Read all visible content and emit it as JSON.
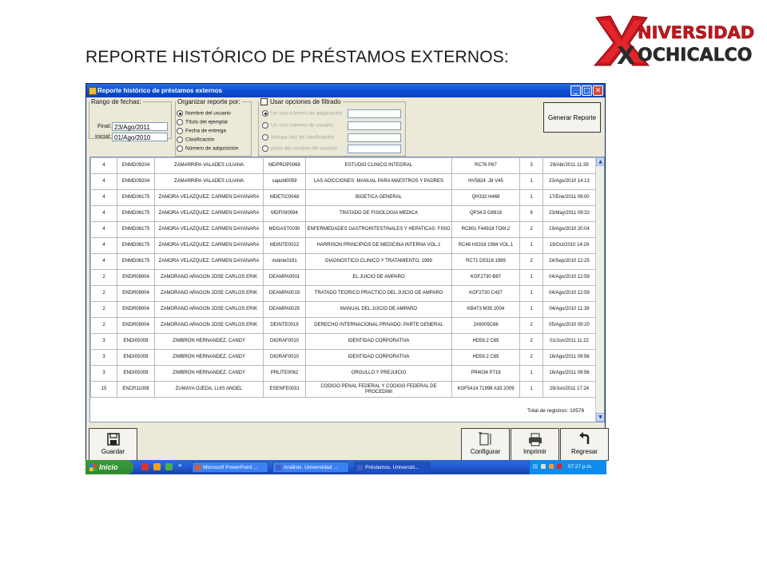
{
  "slide": {
    "title": "REPORTE  HISTÓRICO DE PRÉSTAMOS EXTERNOS:"
  },
  "logo": {
    "line1": "NIVERSIDAD",
    "line2": "OCHICALCO",
    "letter": "X",
    "brand_color": "#c8161d"
  },
  "window": {
    "title": "Reporte histórico de préstamos externos",
    "controls": {
      "minimize": "_",
      "maximize": "□",
      "close": "✕"
    }
  },
  "date_range": {
    "legend": "Rango de fechas:",
    "start_label": "Inicial:",
    "start_value": "01/Ago/2010",
    "end_label": "Final:",
    "end_value": "23/Ago/2011"
  },
  "organize": {
    "legend": "Organizar reporte por:",
    "options": [
      "Nombre del usuario",
      "Título del ejemplar",
      "Fecha de entrega",
      "Clasificación",
      "Número de adquisición"
    ],
    "selected_index": 0
  },
  "filter": {
    "checkbox_label": "Usar opciones de filtrado",
    "checked": false,
    "options": [
      "Un solo número de adquisición",
      "Un solo número de usuario",
      "Incluya raíz de clasificación",
      "parte del nombre del usuario"
    ]
  },
  "actions": {
    "generate": "Generar Reporte"
  },
  "table": {
    "rows": [
      [
        "4",
        "ENMD09204",
        "ZAMARRIPA VALADES LILIANA",
        "MDPROP0068",
        "ESTUDIO CLINICO INTEGRAL",
        "RC76 P67",
        "3",
        "29/Abr/2011 11:39"
      ],
      [
        "4",
        "ENMD09204",
        "ZAMARRIPA VALADES LILIANA",
        "sapubl0059",
        "LAS ADICCIONES: MANUAL PARA MAESTROS Y PADRES",
        "HV5824 .J8 V45",
        "1",
        "23/Ago/2010 14:13"
      ],
      [
        "4",
        "ENMD06175",
        "ZAMORA VELAZQUEZ, CARMEN DAYANARA",
        "MDETIC0048",
        "BIOETICA GENERAL",
        "QH332 H468",
        "1",
        "17/Ene/2011 09:00"
      ],
      [
        "4",
        "ENMD06175",
        "ZAMORA VELAZQUEZ, CARMEN DAYANARA",
        "MDFISI0094",
        "TRATADO DE FISIOLOGIA MEDICA",
        "QP34.5 G8918",
        "9",
        "23/May/2011 09:32"
      ],
      [
        "4",
        "ENMD06175",
        "ZAMORA VELAZQUEZ, CARMEN DAYANARA",
        "MDGAST0030",
        "ENFERMEDADES GASTROINTESTINALES Y HEPATICAS: FISIO",
        "RC801 F44918 TOM.2",
        "2",
        "19/Ago/2010 20:04"
      ],
      [
        "4",
        "ENMD06175",
        "ZAMORA VELAZQUEZ, CARMEN DAYANARA",
        "MDINTE0022",
        "HARRISON PRINCIPIOS DE MEDICINA INTERNA VOL.1",
        "RC46 H3318 1994 VOL.1",
        "1",
        "19/Oct/2010 14:29"
      ],
      [
        "4",
        "ENMD06175",
        "ZAMORA VELAZQUEZ, CARMEN DAYANARA",
        "mdinte0191",
        "DIAGNOSTICO CLINICO Y TRATAMIENTO, 1999",
        "RC71 D5318 1999",
        "2",
        "24/Sep/2010 12:25"
      ],
      [
        "2",
        "ENDR08004",
        "ZAMORANO ARAGON JOSE CARLOS ERIK",
        "DEAMPA0001",
        "EL JUICIO DE AMPARO",
        "KGF2730 B87",
        "1",
        "04/Ago/2010 12:59"
      ],
      [
        "2",
        "ENDR08004",
        "ZAMORANO ARAGON JOSE CARLOS ERIK",
        "DEAMPA0019",
        "TRATADO TEORICO PRACTICO DEL JUICIO DE AMPARO",
        "KGF2730 C437",
        "1",
        "04/Ago/2010 12:59"
      ],
      [
        "2",
        "ENDR08004",
        "ZAMORANO ARAGON JOSE CARLOS ERIK",
        "DEAMPA0025",
        "MANUAL DEL JUICIO DE AMPARO",
        "KB473 M35 2004",
        "1",
        "04/Ago/2010 11:39"
      ],
      [
        "2",
        "ENDR08004",
        "ZAMORANO ARAGON JOSE CARLOS ERIK",
        "DEINTE0019",
        "DERECHO INTERNACIONAL PRIVADO: PARTE GENERAL",
        "JX6005C66",
        "2",
        "05/Ago/2010 09:20"
      ],
      [
        "3",
        "ENDI05009",
        "ZIMBRON HERNANDEZ, CANDY",
        "DIGRAF0010",
        "IDENTIDAD CORPORATIVA",
        "HD59.2 C65",
        "2",
        "01/Jun/2011 11:22"
      ],
      [
        "3",
        "ENDI05009",
        "ZIMBRON HERNANDEZ, CANDY",
        "DIGRAF0010",
        "IDENTIDAD CORPORATIVA",
        "HD59.2 C65",
        "2",
        "16/Ago/2011 09:56"
      ],
      [
        "3",
        "ENDI05009",
        "ZIMBRON HERNANDEZ, CANDY",
        "PRLITE0062",
        "ORGULLO Y PREJUICIO",
        "PR4034 P718",
        "1",
        "16/Ago/2011 09:56"
      ],
      [
        "15",
        "ENCR11006",
        "ZUMAYA OJEDA, LUIS ANGEL",
        "ESENFE0031",
        "CODIGO PENAL FEDERAL Y CODIGO FEDERAL DE PROCEDIMI",
        "KGF5414.71998 A33 2009",
        "1",
        "29/Jun/2011 17:24"
      ]
    ],
    "total_label": "Total de registros: 10576"
  },
  "buttons": {
    "save": "Guardar",
    "configure": "Configurar",
    "print": "Imprimir",
    "back": "Regresar"
  },
  "taskbar": {
    "start": "Inicio",
    "overflow": "»",
    "tasks": [
      "Microsoft PowerPoint ...",
      "Análisis. Universidad ...",
      "Préstamos. Universid..."
    ],
    "clock": "07:27 p.m."
  }
}
